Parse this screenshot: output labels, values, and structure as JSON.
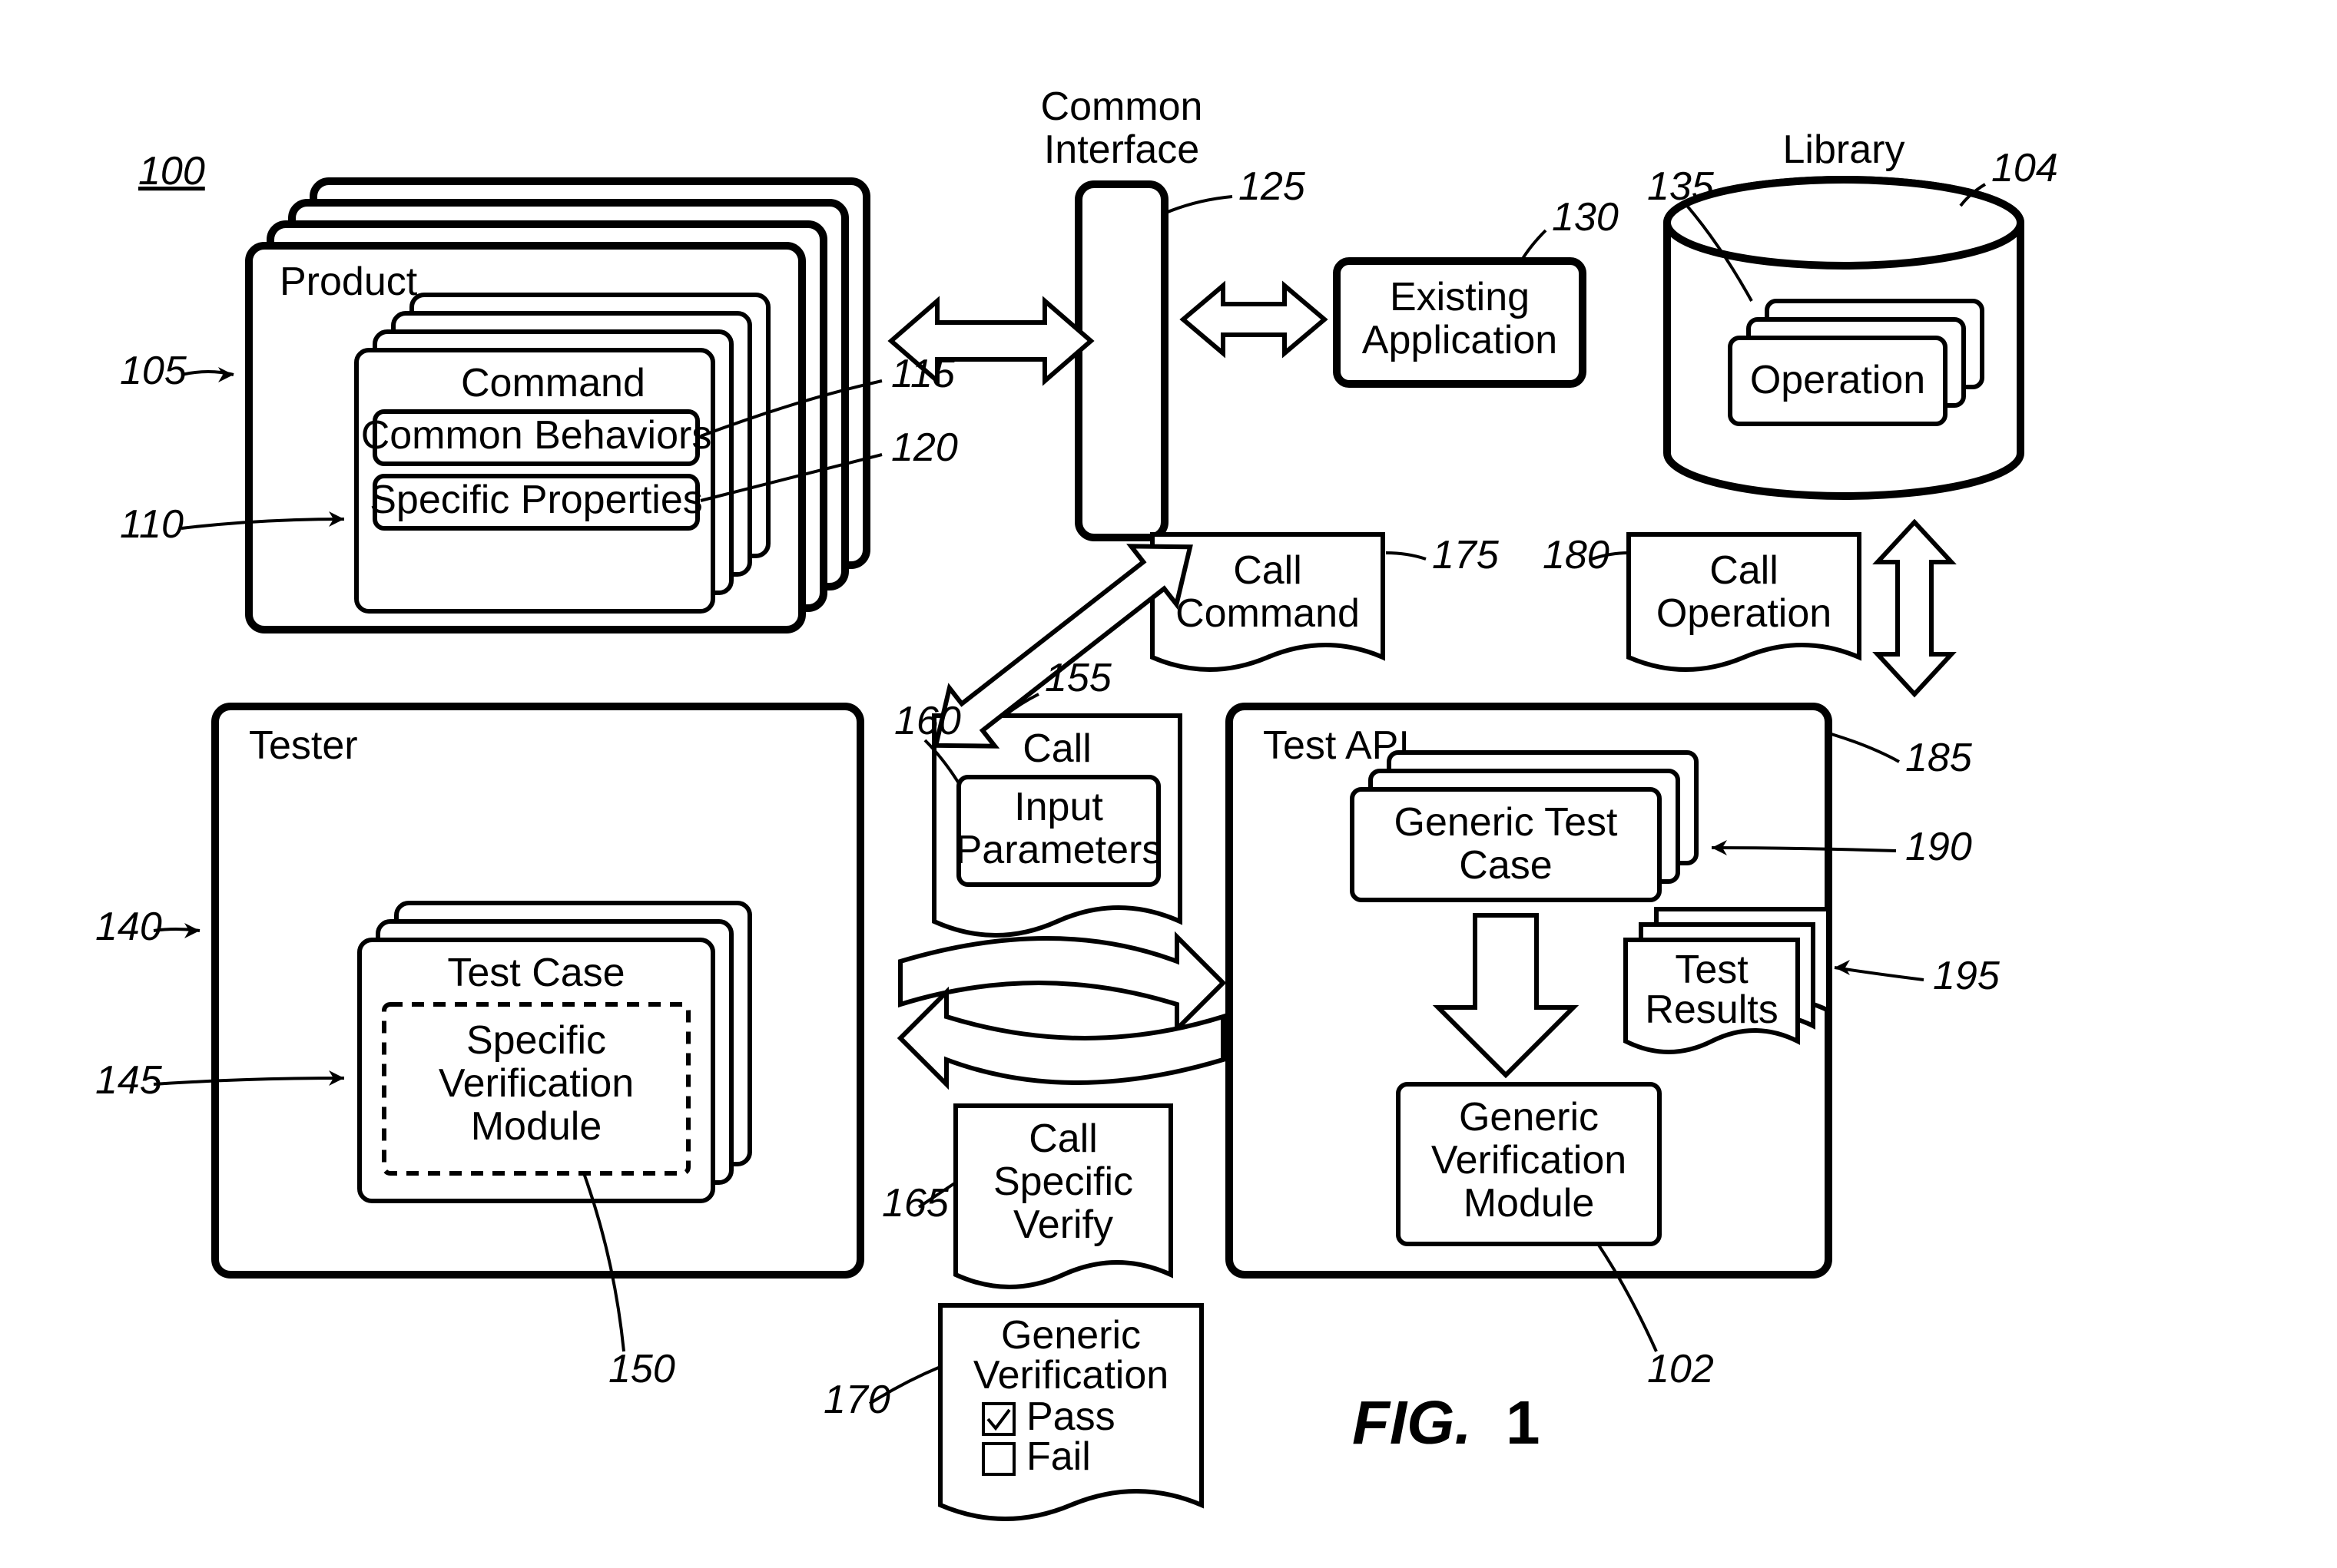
{
  "figure": {
    "label": "FIG.",
    "number": "1"
  },
  "refs": {
    "r100": "100",
    "r102": "102",
    "r104": "104",
    "r105": "105",
    "r110": "110",
    "r115": "115",
    "r120": "120",
    "r125": "125",
    "r130": "130",
    "r135": "135",
    "r140": "140",
    "r145": "145",
    "r150": "150",
    "r155": "155",
    "r160": "160",
    "r165": "165",
    "r170": "170",
    "r175": "175",
    "r180": "180",
    "r185": "185",
    "r190": "190",
    "r195": "195"
  },
  "product": {
    "title": "Product",
    "command": {
      "title": "Command",
      "behaviors": "Common Behaviors",
      "properties": "Specific Properties"
    }
  },
  "common_interface": {
    "line1": "Common",
    "line2": "Interface"
  },
  "existing_app": {
    "line1": "Existing",
    "line2": "Application"
  },
  "library": {
    "title": "Library",
    "operation": "Operation"
  },
  "tester": {
    "title": "Tester",
    "test_case": {
      "title": "Test Case",
      "verify1": "Specific",
      "verify2": "Verification",
      "verify3": "Module"
    }
  },
  "call": {
    "title": "Call",
    "input1": "Input",
    "input2": "Parameters"
  },
  "call_specific": {
    "line1": "Call",
    "line2": "Specific",
    "line3": "Verify"
  },
  "generic_verif_doc": {
    "line1": "Generic",
    "line2": "Verification",
    "pass": "Pass",
    "fail": "Fail"
  },
  "call_command": {
    "line1": "Call",
    "line2": "Command"
  },
  "call_operation": {
    "line1": "Call",
    "line2": "Operation"
  },
  "test_api": {
    "title": "Test API",
    "generic_tc1": "Generic Test",
    "generic_tc2": "Case",
    "results1": "Test",
    "results2": "Results",
    "gvm1": "Generic",
    "gvm2": "Verification",
    "gvm3": "Module"
  }
}
